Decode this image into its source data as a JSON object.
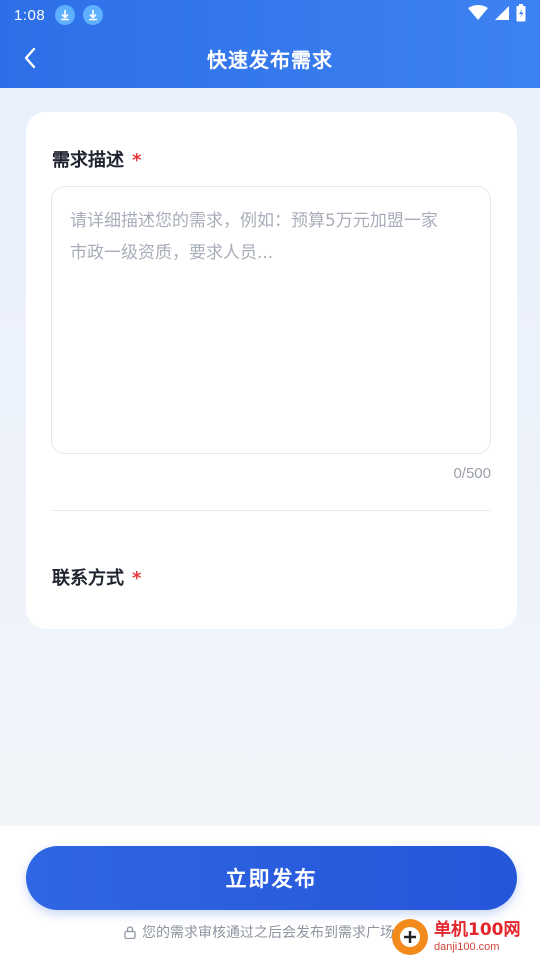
{
  "status_bar": {
    "time": "1:08",
    "icons": [
      "download-icon",
      "download-icon",
      "wifi-icon",
      "signal-icon",
      "battery-icon"
    ]
  },
  "header": {
    "title": "快速发布需求",
    "back_icon": "chevron-left-icon"
  },
  "form": {
    "description": {
      "label": "需求描述",
      "required_mark": "*",
      "placeholder": "请详细描述您的需求，例如：预算5万元加盟一家\n市政一级资质，要求人员...",
      "value": "",
      "counter": "0/500"
    },
    "contact": {
      "label": "联系方式",
      "required_mark": "*"
    }
  },
  "footer": {
    "publish_label": "立即发布",
    "note": "您的需求审核通过之后会发布到需求广场",
    "lock_icon": "lock-icon"
  },
  "watermark": {
    "title": "单机100网",
    "url": "danji100.com"
  },
  "colors": {
    "header_start": "#2d6fe8",
    "header_end": "#3d82f2",
    "primary_button": "#2456d9",
    "required": "#e4393c",
    "placeholder": "#a8aeb9"
  }
}
